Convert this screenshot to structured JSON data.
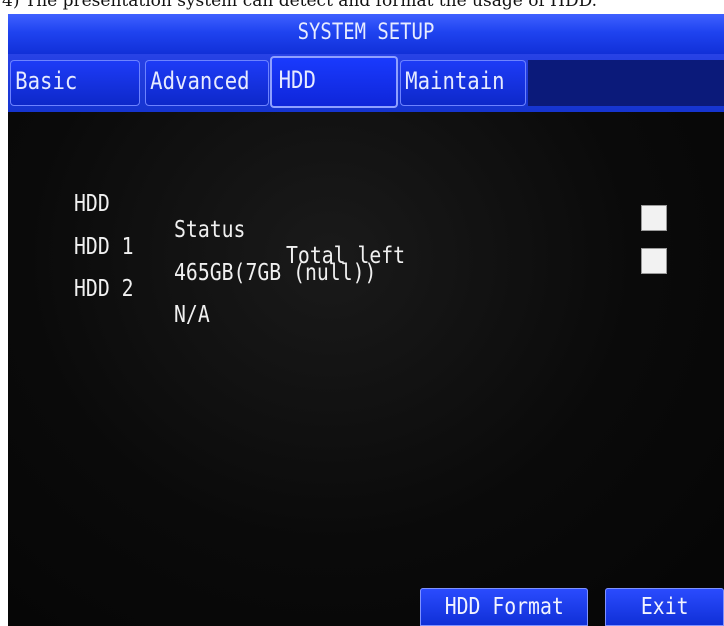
{
  "page_caption": "4) The presentation system can detect and format the usage of HDD.",
  "window": {
    "title": "SYSTEM SETUP"
  },
  "tabs": [
    {
      "label": "Basic",
      "active": false
    },
    {
      "label": "Advanced",
      "active": false
    },
    {
      "label": "HDD",
      "active": true
    },
    {
      "label": "Maintain",
      "active": false
    }
  ],
  "table": {
    "header": {
      "hdd": "HDD",
      "status": "Status",
      "total_left": "Total left"
    },
    "rows": [
      {
        "hdd": "HDD 1",
        "info": "465GB(7GB (null))",
        "selected": false
      },
      {
        "hdd": "HDD 2",
        "info": "N/A",
        "selected": false
      }
    ]
  },
  "buttons": {
    "format": "HDD Format",
    "exit": "Exit"
  },
  "colors": {
    "accent_blue": "#1f43f0",
    "background": "#0a0a0a",
    "text": "#f0f0f0"
  }
}
